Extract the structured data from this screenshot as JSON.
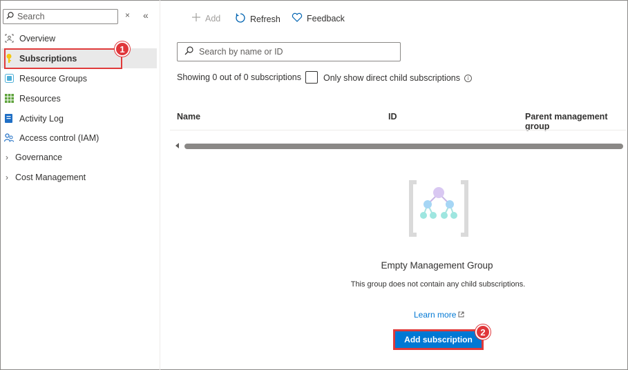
{
  "sidebar": {
    "search_placeholder": "Search",
    "clear_glyph": "×",
    "collapse_glyph": "«",
    "items": [
      {
        "label": "Overview",
        "icon": "overview-icon"
      },
      {
        "label": "Subscriptions",
        "icon": "key-icon",
        "selected": true
      },
      {
        "label": "Resource Groups",
        "icon": "resource-groups-icon"
      },
      {
        "label": "Resources",
        "icon": "grid-icon"
      },
      {
        "label": "Activity Log",
        "icon": "activity-log-icon"
      },
      {
        "label": "Access control (IAM)",
        "icon": "people-icon"
      },
      {
        "label": "Governance",
        "icon": "chevron-right-icon"
      },
      {
        "label": "Cost Management",
        "icon": "chevron-right-icon"
      }
    ]
  },
  "toolbar": {
    "add_label": "Add",
    "refresh_label": "Refresh",
    "feedback_label": "Feedback"
  },
  "main": {
    "search_placeholder": "Search by name or ID",
    "showing_text": "Showing 0 out of 0 subscriptions",
    "checkbox_label": "Only show direct child subscriptions",
    "columns": [
      "Name",
      "ID",
      "Parent management group"
    ],
    "empty_title": "Empty Management Group",
    "empty_desc": "This group does not contain any child subscriptions.",
    "learn_more": "Learn more",
    "add_subscription": "Add subscription"
  },
  "annotations": {
    "badge_1": "1",
    "badge_2": "2"
  },
  "colors": {
    "accent": "#0078d4",
    "highlight": "#e03a3a"
  }
}
